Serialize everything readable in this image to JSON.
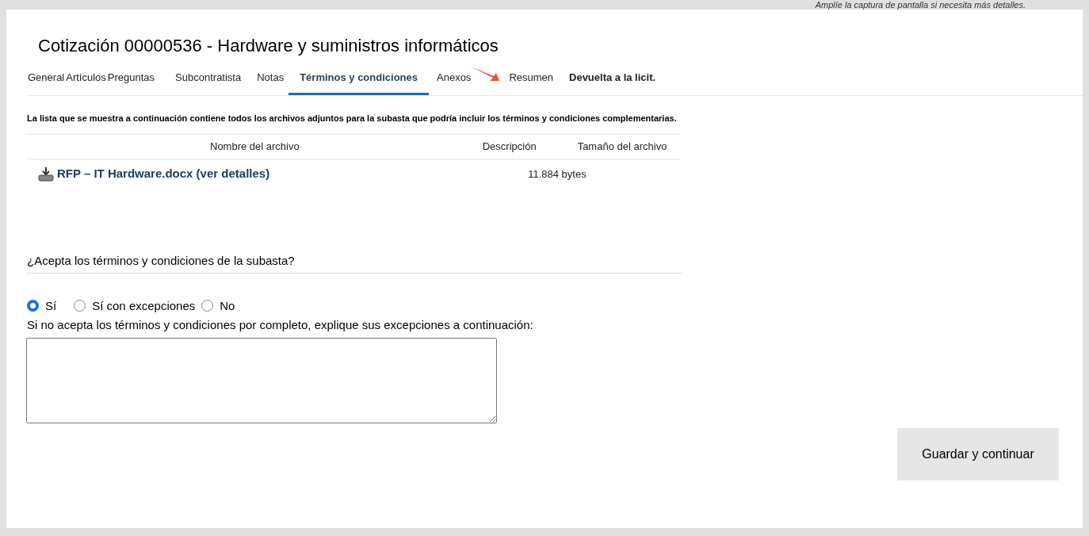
{
  "note": "Amplíe la captura de pantalla si necesita más detalles.",
  "title": "Cotización 00000536 - Hardware y suministros informáticos",
  "tabs": [
    {
      "label": "General",
      "selected": false,
      "kind": "tab"
    },
    {
      "label": "Artículos",
      "selected": false,
      "kind": "tab"
    },
    {
      "label": "Preguntas",
      "selected": false,
      "kind": "tab"
    },
    {
      "label": "Subcontratista",
      "selected": false,
      "kind": "tab"
    },
    {
      "label": "Notas",
      "selected": false,
      "kind": "tab"
    },
    {
      "label": "Términos y condiciones",
      "selected": true,
      "kind": "tab"
    },
    {
      "label": "Anexos",
      "selected": false,
      "kind": "tab"
    },
    {
      "label": "Resumen",
      "selected": false,
      "kind": "tab"
    },
    {
      "label": "Devuelta a la licit.",
      "selected": false,
      "kind": "link"
    }
  ],
  "intro": "La lista que se muestra a continuación contiene todos los archivos adjuntos para la subasta que podría incluir los términos y condiciones complementarias.",
  "table": {
    "columns": [
      "Nombre del archivo",
      "Descripción",
      "Tamaño del archivo"
    ],
    "rows": [
      {
        "file": "RFP – IT Hardware.docx (ver detalles)",
        "size": "11.884 bytes"
      }
    ]
  },
  "question": "¿Acepta los términos y condiciones de la subasta?",
  "options": [
    {
      "label": "Sí",
      "selected": true
    },
    {
      "label": "Sí con excepciones",
      "selected": false
    },
    {
      "label": "No",
      "selected": false
    }
  ],
  "exceptions_label": "Si no acepta los términos y condiciones por completo, explique sus excepciones a continuación:",
  "save_button": "Guardar y continuar"
}
